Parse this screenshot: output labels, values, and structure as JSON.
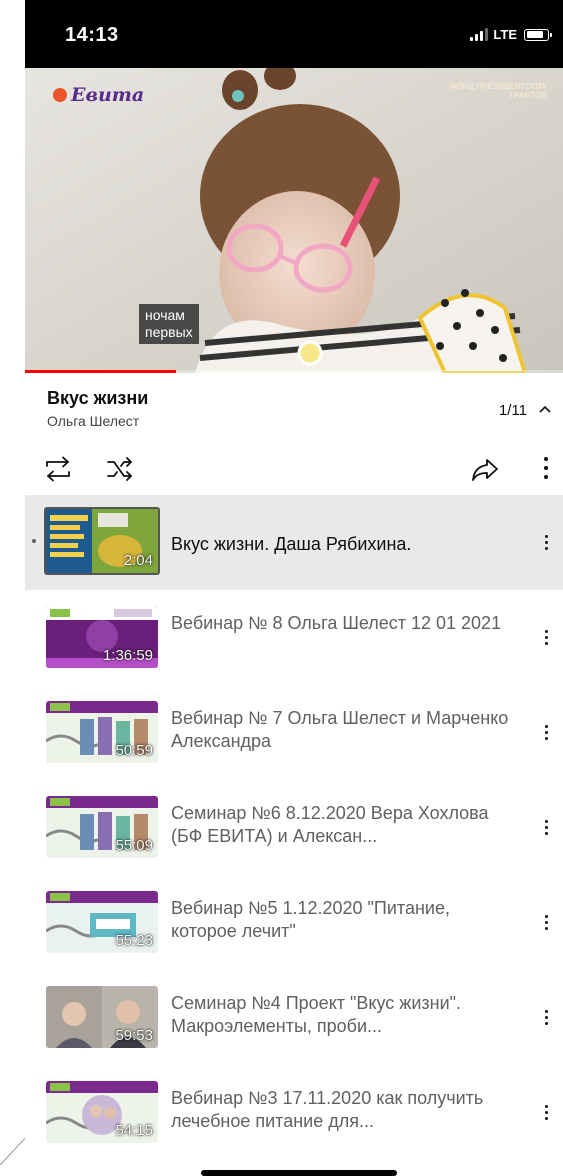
{
  "status_bar": {
    "time": "14:13",
    "network": "LTE"
  },
  "video": {
    "brand_left": "Евита",
    "brand_right": "ФОНД ПРЕЗИДЕНТСКИХ ГРАНТОВ",
    "caption_line1": "ночам",
    "caption_line2": "первых",
    "progress_fraction": 0.28
  },
  "playlist": {
    "title": "Вкус жизни",
    "author": "Ольга Шелест",
    "position": "1/11"
  },
  "controls": [
    "repeat-icon",
    "shuffle-icon",
    "share-icon",
    "more-vertical-icon"
  ],
  "items": [
    {
      "title": "Вкус жизни.  Даша Рябихина.",
      "duration": "2:04",
      "active": true
    },
    {
      "title": "Вебинар № 8 Ольга Шелест 12 01 2021",
      "duration": "1:36:59"
    },
    {
      "title": "Вебинар № 7 Ольга Шелест и Марченко Александра",
      "duration": "50:59"
    },
    {
      "title": "Семинар №6  8.12.2020  Вера Хохлова (БФ ЕВИТА) и Алексан...",
      "duration": "55:09"
    },
    {
      "title": "Вебинар №5  1.12.2020 \"Питание, которое лечит\"",
      "duration": "55:23"
    },
    {
      "title": "Семинар №4 Проект \"Вкус жизни\". Макроэлементы, проби...",
      "duration": "59:53"
    },
    {
      "title": "Вебинар №3 17.11.2020 как получить лечебное питание для...",
      "duration": "54:15"
    }
  ],
  "colors": {
    "progress": "#ff0000",
    "active_row": "#e9e9e9",
    "secondary_text": "#606060"
  }
}
